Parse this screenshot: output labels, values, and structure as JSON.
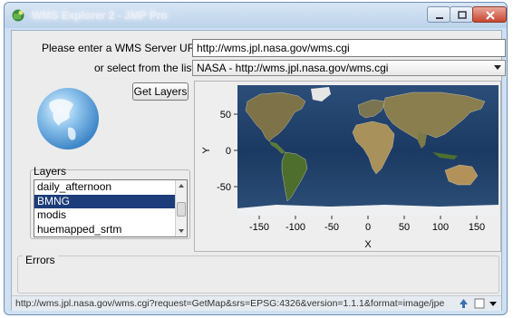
{
  "window": {
    "title": "WMS Explorer 2 - JMP Pro"
  },
  "form": {
    "url_label": "Please enter a WMS Server URL:",
    "url_value": "http://wms.jpl.nasa.gov/wms.cgi",
    "select_label": "or select from the list:",
    "select_value": "NASA - http://wms.jpl.nasa.gov/wms.cgi",
    "get_layers_label": "Get Layers"
  },
  "layers": {
    "title": "Layers",
    "items": [
      "daily_afternoon",
      "BMNG",
      "modis",
      "huemapped_srtm"
    ],
    "selected": "BMNG"
  },
  "plot": {
    "x_label": "X",
    "y_label": "Y",
    "x_ticks": [
      "-150",
      "-100",
      "-50",
      "0",
      "50",
      "100",
      "150"
    ],
    "y_ticks": [
      "50",
      "0",
      "-50"
    ]
  },
  "errors": {
    "title": "Errors"
  },
  "status": {
    "text": "http://wms.jpl.nasa.gov/wms.cgi?request=GetMap&srs=EPSG:4326&version=1.1.1&format=image/jpe"
  },
  "colors": {
    "selection": "#1c3c7a",
    "ocean": "#18385f",
    "land": "#8a7a52"
  }
}
